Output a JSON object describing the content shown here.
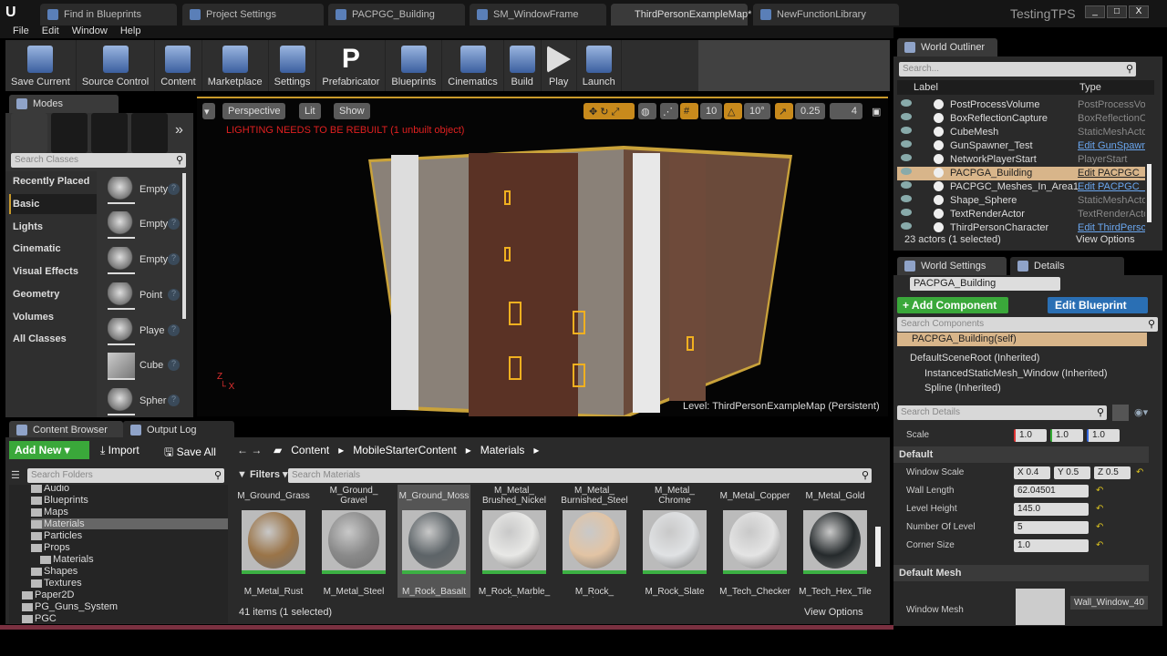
{
  "window": {
    "project": "TestingTPS",
    "tabs": [
      "Find in Blueprints",
      "Project Settings",
      "PACPGC_Building",
      "SM_WindowFrame",
      "ThirdPersonExampleMap*",
      "NewFunctionLibrary"
    ],
    "active_tab": 4,
    "controls": [
      "_",
      "□",
      "X"
    ]
  },
  "menu": [
    "File",
    "Edit",
    "Window",
    "Help"
  ],
  "toolbar": [
    "Save Current",
    "Source Control",
    "Content",
    "Marketplace",
    "Settings",
    "Prefabricator",
    "Blueprints",
    "Cinematics",
    "Build",
    "Play",
    "Launch"
  ],
  "modes": {
    "title": "Modes",
    "search_placeholder": "Search Classes",
    "categories": [
      "Recently Placed",
      "Basic",
      "Lights",
      "Cinematic",
      "Visual Effects",
      "Geometry",
      "Volumes",
      "All Classes"
    ],
    "selected_category": "Basic",
    "items": [
      "Empty",
      "Empty",
      "Empty",
      "Point",
      "Playe",
      "Cube",
      "Spher"
    ]
  },
  "viewport": {
    "perspective": "Perspective",
    "lit": "Lit",
    "show": "Show",
    "grid": "10",
    "rot": "10°",
    "scale": "0.25",
    "speed": "4",
    "warning": "LIGHTING NEEDS TO BE REBUILT (1 unbuilt object)",
    "level": "Level:  ThirdPersonExampleMap (Persistent)"
  },
  "outliner": {
    "title": "World Outliner",
    "search_placeholder": "Search...",
    "col_label": "Label",
    "col_type": "Type",
    "rows": [
      {
        "label": "PostProcessVolume",
        "type": "PostProcessVol",
        "link": false
      },
      {
        "label": "BoxReflectionCapture",
        "type": "BoxReflectionC",
        "link": false
      },
      {
        "label": "CubeMesh",
        "type": "StaticMeshActo",
        "link": false
      },
      {
        "label": "GunSpawner_Test",
        "type": "Edit GunSpawn",
        "link": true
      },
      {
        "label": "NetworkPlayerStart",
        "type": "PlayerStart",
        "link": false
      },
      {
        "label": "PACPGA_Building",
        "type": "Edit PACPGC_B",
        "link": true,
        "selected": true
      },
      {
        "label": "PACPGC_Meshes_In_Area1",
        "type": "Edit PACPGC_M",
        "link": true
      },
      {
        "label": "Shape_Sphere",
        "type": "StaticMeshActo",
        "link": false
      },
      {
        "label": "TextRenderActor",
        "type": "TextRenderActo",
        "link": false
      },
      {
        "label": "ThirdPersonCharacter",
        "type": "Edit ThirdPersc",
        "link": true
      }
    ],
    "count": "23 actors (1 selected)",
    "view_options": "View Options"
  },
  "details": {
    "tab_world": "World Settings",
    "tab_details": "Details",
    "actor_name": "PACPGA_Building",
    "add_component": "+ Add Component",
    "edit_blueprint": "Edit Blueprint",
    "search_components": "Search Components",
    "components": [
      "PACPGA_Building(self)",
      "DefaultSceneRoot (Inherited)",
      "InstancedStaticMesh_Window (Inherited)",
      "Spline (Inherited)"
    ],
    "search_details": "Search Details",
    "scale_label": "Scale",
    "scale": [
      "1.0",
      "1.0",
      "1.0"
    ],
    "section_default": "Default",
    "window_scale_label": "Window Scale",
    "window_scale": [
      "X 0.4",
      "Y 0.5",
      "Z 0.5"
    ],
    "props": [
      {
        "label": "Wall Length",
        "value": "62.04501"
      },
      {
        "label": "Level Height",
        "value": "145.0"
      },
      {
        "label": "Number Of Level",
        "value": "5"
      },
      {
        "label": "Corner Size",
        "value": "1.0"
      }
    ],
    "section_mesh": "Default Mesh",
    "window_mesh_label": "Window Mesh",
    "window_mesh": "Wall_Window_40"
  },
  "content_browser": {
    "tab": "Content Browser",
    "tab2": "Output Log",
    "add_new": "Add New",
    "import": "Import",
    "save_all": "Save All",
    "path": [
      "Content",
      "MobileStarterContent",
      "Materials"
    ],
    "search_folders": "Search Folders",
    "filters": "Filters",
    "search_materials": "Search Materials",
    "folders": [
      "Audio",
      "Blueprints",
      "Maps",
      "Materials",
      "Particles",
      "Props",
      "Materials",
      "Shapes",
      "Textures",
      "Paper2D",
      "PG_Guns_System",
      "PGC"
    ],
    "top_labels": [
      "M_Ground_Grass",
      "M_Ground_ Gravel",
      "M_Ground_Moss",
      "M_Metal_ Brushed_Nickel",
      "M_Metal_ Burnished_Steel",
      "M_Metal_ Chrome",
      "M_Metal_Copper",
      "M_Metal_Gold"
    ],
    "assets": [
      "M_Metal_Rust",
      "M_Metal_Steel",
      "M_Rock_Basalt",
      "M_Rock_Marble_ Polished",
      "M_Rock_ Sandstone",
      "M_Rock_Slate",
      "M_Tech_Checker Dot",
      "M_Tech_Hex_Tile"
    ],
    "asset_colors": [
      "#9a7448",
      "#8a8a8a",
      "#5d6468",
      "#e8e8e6",
      "#e2c4a4",
      "#e0e2e4",
      "#e4e4e4",
      "#252a2c"
    ],
    "count": "41 items (1 selected)",
    "view_options": "View Options"
  }
}
